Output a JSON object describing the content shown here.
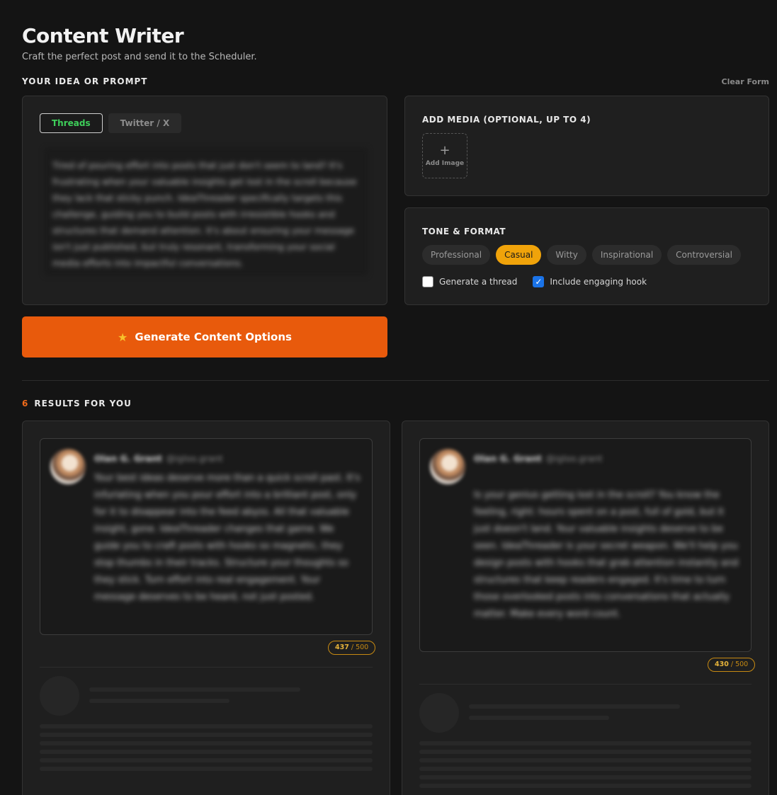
{
  "header": {
    "title": "Content Writer",
    "subtitle": "Craft the perfect post and send it to the Scheduler."
  },
  "prompt_section": {
    "label": "YOUR IDEA OR PROMPT",
    "clear_label": "Clear Form",
    "tabs": [
      {
        "label": "Threads",
        "active": true
      },
      {
        "label": "Twitter / X",
        "active": false
      }
    ],
    "prompt_text": "Tired of pouring effort into posts that just don't seem to land? It's frustrating when your valuable insights get lost in the scroll because they lack that sticky punch. IdeaThreader specifically targets this challenge, guiding you to build posts with irresistible hooks and structures that demand attention. It's about ensuring your message isn't just published, but truly resonant, transforming your social media efforts into impactful conversations."
  },
  "media_section": {
    "heading": "ADD MEDIA (OPTIONAL, UP TO 4)",
    "add_icon": "plus-icon",
    "add_label": "Add Image"
  },
  "tone_section": {
    "heading": "TONE & FORMAT",
    "tones": [
      {
        "label": "Professional",
        "active": false
      },
      {
        "label": "Casual",
        "active": true
      },
      {
        "label": "Witty",
        "active": false
      },
      {
        "label": "Inspirational",
        "active": false
      },
      {
        "label": "Controversial",
        "active": false
      }
    ],
    "options": [
      {
        "label": "Generate a thread",
        "checked": false
      },
      {
        "label": "Include engaging hook",
        "checked": true
      }
    ]
  },
  "generate": {
    "icon": "star-icon",
    "label": "Generate Content Options"
  },
  "results": {
    "count": "6",
    "label": "RESULTS FOR YOU",
    "items": [
      {
        "author": "Olan G. Grant",
        "handle": "@igloo.grant",
        "body": "Your best ideas deserve more than a quick scroll past. It's infuriating when you pour effort into a brilliant post, only for it to disappear into the feed abyss. All that valuable insight, gone. IdeaThreader changes that game. We guide you to craft posts with hooks so magnetic, they stop thumbs in their tracks. Structure your thoughts so they stick. Turn effort into real engagement. Your message deserves to be heard, not just posted.",
        "chars": "437",
        "limit": "/ 500"
      },
      {
        "author": "Olan G. Grant",
        "handle": "@igloo.grant",
        "body": "Is your genius getting lost in the scroll? You know the feeling, right: hours spent on a post, full of gold, but it just doesn't land. Your valuable insights deserve to be seen. IdeaThreader is your secret weapon. We'll help you design posts with hooks that grab attention instantly and structures that keep readers engaged. It's time to turn those overlooked posts into conversations that actually matter. Make every word count.",
        "chars": "430",
        "limit": "/ 500"
      }
    ]
  },
  "colors": {
    "background": "#141414",
    "accent_orange": "#e85a0c",
    "tone_active": "#f0a30a",
    "tab_active_text": "#3ecf5a",
    "checkbox_on": "#1a73e8"
  }
}
